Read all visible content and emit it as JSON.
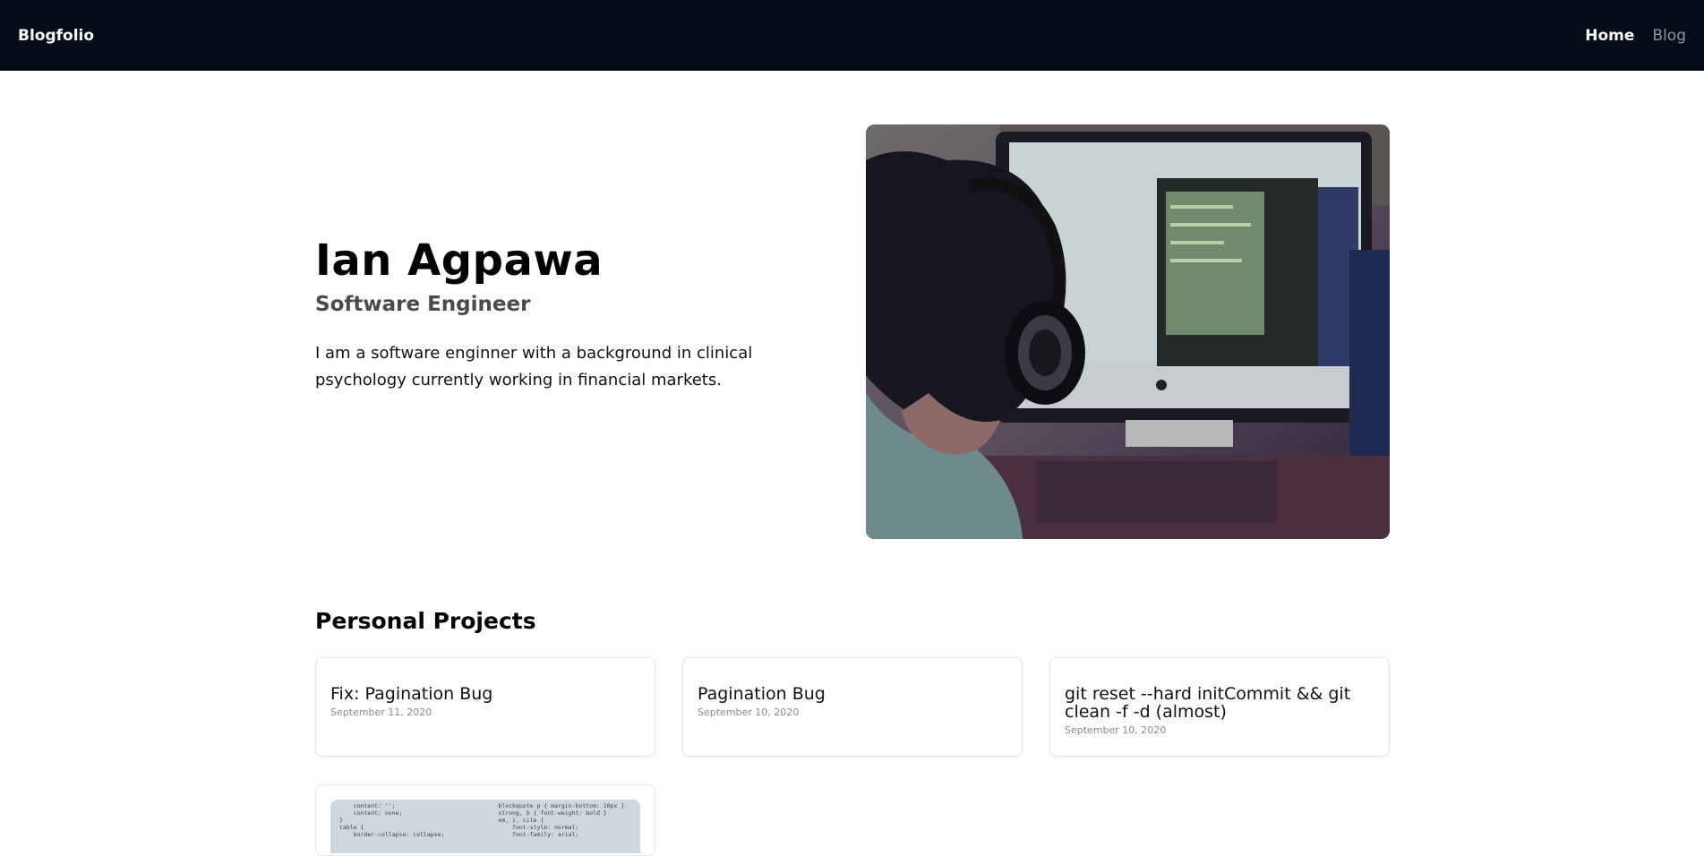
{
  "nav": {
    "brand": "Blogfolio",
    "links": [
      {
        "label": "Home",
        "active": true
      },
      {
        "label": "Blog",
        "active": false
      }
    ]
  },
  "hero": {
    "name": "Ian Agpawa",
    "role": "Software Engineer",
    "bio": "I am a software enginner with a background in clinical psychology currently working in financial markets."
  },
  "projects": {
    "title": "Personal Projects",
    "items": [
      {
        "title": "Fix: Pagination Bug",
        "date": "September 11, 2020"
      },
      {
        "title": "Pagination Bug",
        "date": "September 10, 2020"
      },
      {
        "title": "git reset --hard initCommit && git clean -f -d (almost)",
        "date": "September 10, 2020"
      }
    ],
    "code_preview": {
      "left": "    content: '';\n    content: none;\n}\ntable {\n    border-collapse: collapse;",
      "right": "blockquote p { margin-bottom: 10px }\nstrong, b { font-weight: bold }\nem, i, cite {\n    font-style: normal;\n    font-family: arial;"
    }
  }
}
